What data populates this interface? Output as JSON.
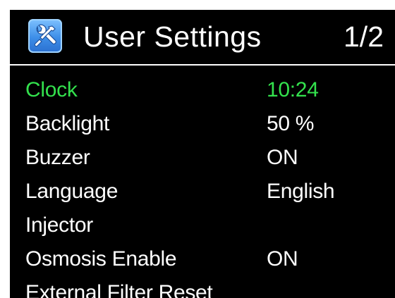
{
  "header": {
    "icon": "tools-icon",
    "title": "User Settings",
    "page_indicator": "1/2"
  },
  "colors": {
    "background": "#000000",
    "text": "#ffffff",
    "selected": "#33e14d",
    "icon_blue": "#3d8ee8"
  },
  "menu": {
    "items": [
      {
        "label": "Clock",
        "value": "10:24",
        "selected": true
      },
      {
        "label": "Backlight",
        "value": "50 %",
        "selected": false
      },
      {
        "label": "Buzzer",
        "value": "ON",
        "selected": false
      },
      {
        "label": "Language",
        "value": "English",
        "selected": false
      },
      {
        "label": "Injector",
        "value": "",
        "selected": false
      },
      {
        "label": "Osmosis Enable",
        "value": "ON",
        "selected": false
      },
      {
        "label": "External Filter Reset",
        "value": "",
        "selected": false
      }
    ]
  }
}
